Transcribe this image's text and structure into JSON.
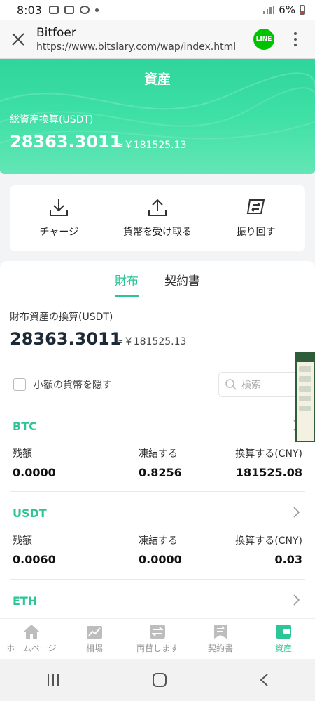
{
  "status_bar": {
    "time": "8:03",
    "battery": "6%"
  },
  "browser": {
    "title": "Bitfoer",
    "url": "https://www.bitslary.com/wap/index.html",
    "share_label": "LINE"
  },
  "header": {
    "title": "資産",
    "total_label": "総資産換算(USDT)",
    "total_amount": "28363.3011",
    "total_approx": "≈￥181525.13"
  },
  "actions": [
    {
      "label": "チャージ",
      "icon": "download-icon"
    },
    {
      "label": "貨幣を受け取る",
      "icon": "upload-icon"
    },
    {
      "label": "振り回す",
      "icon": "transfer-icon"
    }
  ],
  "tabs": [
    {
      "label": "財布",
      "active": true
    },
    {
      "label": "契約書",
      "active": false
    }
  ],
  "wallet": {
    "label": "財布資産の換算(USDT)",
    "amount": "28363.3011",
    "approx": "≈￥181525.13"
  },
  "filters": {
    "hide_small_label": "小額の貨幣を隠す",
    "search_placeholder": "検索"
  },
  "columns": {
    "balance": "残額",
    "frozen": "凍結する",
    "converted": "換算する(CNY)"
  },
  "coins": [
    {
      "name": "BTC",
      "balance": "0.0000",
      "frozen": "0.8256",
      "converted": "181525.08"
    },
    {
      "name": "USDT",
      "balance": "0.0060",
      "frozen": "0.0000",
      "converted": "0.03"
    },
    {
      "name": "ETH",
      "balance": "",
      "frozen": "",
      "converted": ""
    }
  ],
  "bottom_nav": [
    {
      "label": "ホームページ",
      "icon": "home-icon",
      "active": false
    },
    {
      "label": "相場",
      "icon": "chart-icon",
      "active": false
    },
    {
      "label": "両替します",
      "icon": "exchange-icon",
      "active": false
    },
    {
      "label": "契約書",
      "icon": "contract-icon",
      "active": false
    },
    {
      "label": "資産",
      "icon": "wallet-icon",
      "active": true
    }
  ],
  "colors": {
    "accent": "#2cc596",
    "header_green": "#3ee0a5",
    "line_green": "#00c300"
  }
}
